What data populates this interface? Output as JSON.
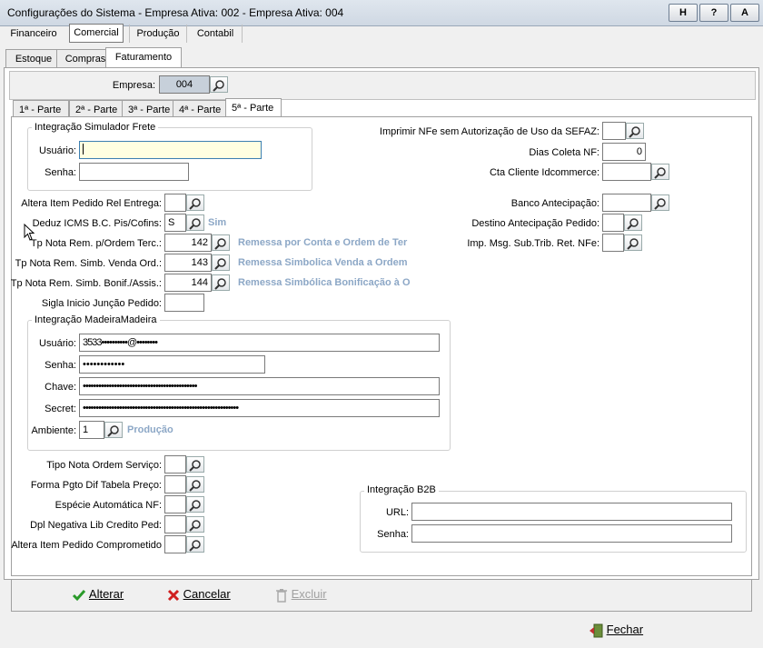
{
  "window": {
    "title": "Configurações do Sistema - Empresa Ativa: 002 - Empresa Ativa: 004",
    "buttons": [
      "H",
      "?",
      "A"
    ]
  },
  "main_tabs": [
    "Financeiro",
    "Comercial",
    "Produção",
    "Contabil"
  ],
  "sub_tabs": [
    "Estoque",
    "Compras",
    "Faturamento"
  ],
  "empresa": {
    "label": "Empresa:",
    "value": "004"
  },
  "part_tabs": [
    "1ª - Parte",
    "2ª - Parte",
    "3ª - Parte",
    "4ª - Parte",
    "5ª - Parte"
  ],
  "frete": {
    "title": "Integração Simulador Frete",
    "usuario_label": "Usuário:",
    "senha_label": "Senha:"
  },
  "left_fields": {
    "altera_item": {
      "label": "Altera Item Pedido Rel Entrega:"
    },
    "deduz_icms": {
      "label": "Deduz ICMS B.C. Pis/Cofins:",
      "value": "S",
      "desc": "Sim"
    },
    "tp_nota_rem": {
      "label": "Tp Nota Rem. p/Ordem Terc.:",
      "value": "142",
      "desc": "Remessa por Conta e Ordem de Ter"
    },
    "tp_nota_simb_venda": {
      "label": "Tp Nota Rem. Simb. Venda Ord.:",
      "value": "143",
      "desc": "Remessa Simbolica Venda a Ordem"
    },
    "tp_nota_simb_bonif": {
      "label": "Tp Nota Rem. Simb. Bonif./Assis.:",
      "value": "144",
      "desc": "Remessa Simbólica Bonificação à O"
    },
    "sigla": {
      "label": "Sigla Inicio Junção Pedido:"
    }
  },
  "right_fields": {
    "imprimir_nfe": {
      "label": "Imprimir NFe sem Autorização de Uso da SEFAZ:"
    },
    "dias_coleta": {
      "label": "Dias Coleta NF:",
      "value": "0"
    },
    "cta_cliente": {
      "label": "Cta Cliente Idcommerce:"
    },
    "banco_antecipacao": {
      "label": "Banco Antecipação:"
    },
    "destino_antecipacao": {
      "label": "Destino Antecipação Pedido:"
    },
    "imp_msg": {
      "label": "Imp. Msg. Sub.Trib. Ret. NFe:"
    }
  },
  "madeira": {
    "title": "Integração MadeiraMadeira",
    "usuario_label": "Usuário:",
    "usuario_value": "3533••••••••••@••••••••",
    "senha_label": "Senha:",
    "senha_value": "••••••••••••",
    "chave_label": "Chave:",
    "chave_value": "••••••••••••••••••••••••••••••••••••••••••••",
    "secret_label": "Secret:",
    "secret_value": "••••••••••••••••••••••••••••••••••••••••••••••••••••••••••••",
    "ambiente_label": "Ambiente:",
    "ambiente_value": "1",
    "ambiente_desc": "Produção"
  },
  "bottom_fields": [
    {
      "label": "Tipo Nota Ordem Serviço:"
    },
    {
      "label": "Forma Pgto Dif Tabela Preço:"
    },
    {
      "label": "Espécie Automática NF:"
    },
    {
      "label": "Dpl Negativa Lib Credito Ped:"
    },
    {
      "label": "Altera Item Pedido Comprometido"
    }
  ],
  "b2b": {
    "title": "Integração B2B",
    "url_label": "URL:",
    "senha_label": "Senha:"
  },
  "actions": {
    "alterar": "Alterar",
    "cancelar": "Cancelar",
    "excluir": "Excluir",
    "fechar": "Fechar"
  },
  "colors": {
    "accent_desc": "#8ca7c6",
    "focus_bg": "#ffffe1",
    "focus_border": "#3c7fb1"
  }
}
